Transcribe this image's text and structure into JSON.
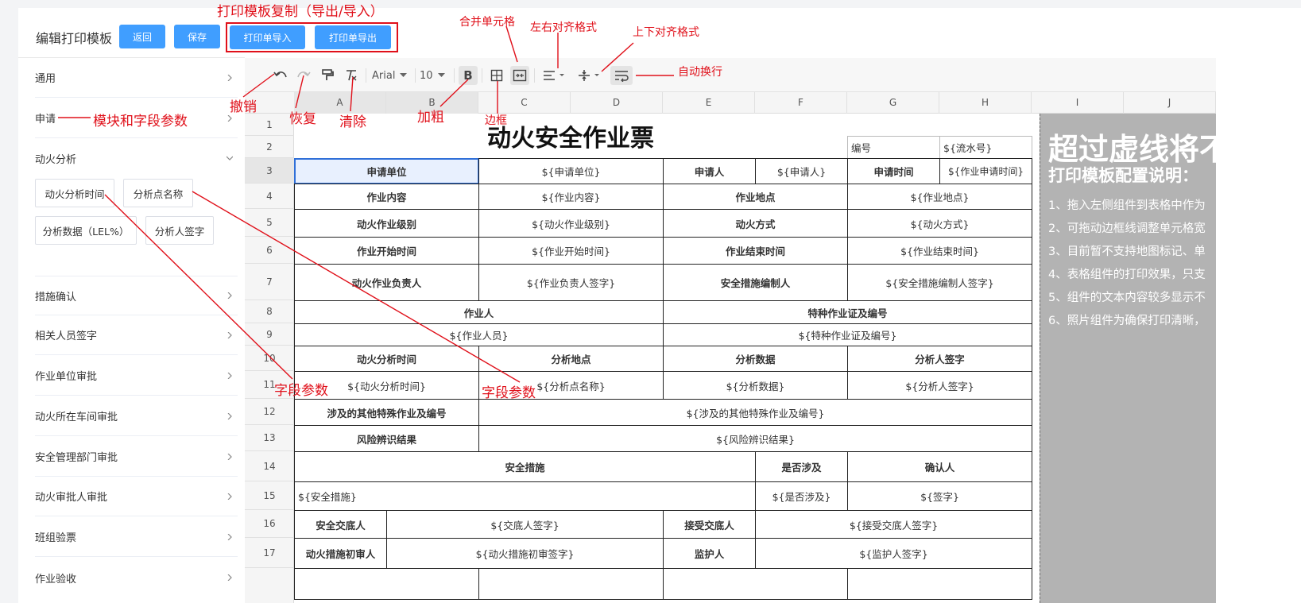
{
  "header": {
    "title": "编辑打印模板",
    "back_label": "返回",
    "save_label": "保存",
    "import_label": "打印单导入",
    "export_label": "打印单导出"
  },
  "sidebar": {
    "items": [
      {
        "label": "通用"
      },
      {
        "label": "申请"
      },
      {
        "label": "动火分析"
      },
      {
        "label": "措施确认"
      },
      {
        "label": "相关人员签字"
      },
      {
        "label": "作业单位审批"
      },
      {
        "label": "动火所在车间审批"
      },
      {
        "label": "安全管理部门审批"
      },
      {
        "label": "动火审批人审批"
      },
      {
        "label": "班组验票"
      },
      {
        "label": "作业验收"
      }
    ],
    "fields": [
      "动火分析时间",
      "分析点名称",
      "分析数据（LEL%）",
      "分析人签字"
    ]
  },
  "toolbar": {
    "font": "Arial",
    "size": "10",
    "bold": "B"
  },
  "columns": [
    "A",
    "B",
    "C",
    "D",
    "E",
    "F",
    "G",
    "H",
    "I",
    "J"
  ],
  "rows": [
    "1",
    "2",
    "3",
    "4",
    "5",
    "6",
    "7",
    "8",
    "9",
    "10",
    "11",
    "12",
    "13",
    "14",
    "15",
    "16",
    "17"
  ],
  "sheet": {
    "title": "动火安全作业票",
    "serial_label": "编号",
    "serial_value": "${流水号}",
    "r3": [
      "申请单位",
      "${申请单位}",
      "申请人",
      "${申请人}",
      "申请时间",
      "${作业申请时间}"
    ],
    "r4": [
      "作业内容",
      "${作业内容}",
      "作业地点",
      "${作业地点}"
    ],
    "r5": [
      "动火作业级别",
      "${动火作业级别}",
      "动火方式",
      "${动火方式}"
    ],
    "r6": [
      "作业开始时间",
      "${作业开始时间}",
      "作业结束时间",
      "${作业结束时间}"
    ],
    "r7": [
      "动火作业负责人",
      "${作业负责人签字}",
      "安全措施编制人",
      "${安全措施编制人签字}"
    ],
    "r8": [
      "作业人",
      "特种作业证及编号"
    ],
    "r9": [
      "${作业人员}",
      "${特种作业证及编号}"
    ],
    "r10": [
      "动火分析时间",
      "分析地点",
      "分析数据",
      "分析人签字"
    ],
    "r11": [
      "${动火分析时间}",
      "${分析点名称}",
      "${分析数据}",
      "${分析人签字}"
    ],
    "r12": [
      "涉及的其他特殊作业及编号",
      "${涉及的其他特殊作业及编号}"
    ],
    "r13": [
      "风险辨识结果",
      "${风险辨识结果}"
    ],
    "r14": [
      "安全措施",
      "是否涉及",
      "确认人"
    ],
    "r15": [
      "${安全措施}",
      "${是否涉及}",
      "${签字}"
    ],
    "r16": [
      "安全交底人",
      "${交底人签字}",
      "接受交底人",
      "${接受交底人签字}"
    ],
    "r17": [
      "动火措施初审人",
      "${动火措施初审签字}",
      "监护人",
      "${监护人签字}"
    ]
  },
  "notes": {
    "heading": "超过虚线将不",
    "subheading": "打印模板配置说明：",
    "lines": [
      "1、拖入左侧组件到表格中作为",
      "2、可拖动边框线调整单元格宽",
      "3、目前暂不支持地图标记、单",
      "4、表格组件的打印效果，只支",
      "5、组件的文本内容较多显示不",
      "6、照片组件为确保打印清晰，"
    ]
  },
  "annotations": {
    "copy": "打印模板复制（导出/导入）",
    "merge": "合并单元格",
    "halign": "左右对齐格式",
    "valign": "上下对齐格式",
    "wrap": "自动换行",
    "undo": "撤销",
    "redo": "恢复",
    "clear": "清除",
    "bold": "加粗",
    "border": "边框",
    "module": "模块和字段参数",
    "field1": "字段参数",
    "field2": "字段参数"
  },
  "colors": {
    "primary": "#409eff",
    "annotation": "#e0101a"
  }
}
